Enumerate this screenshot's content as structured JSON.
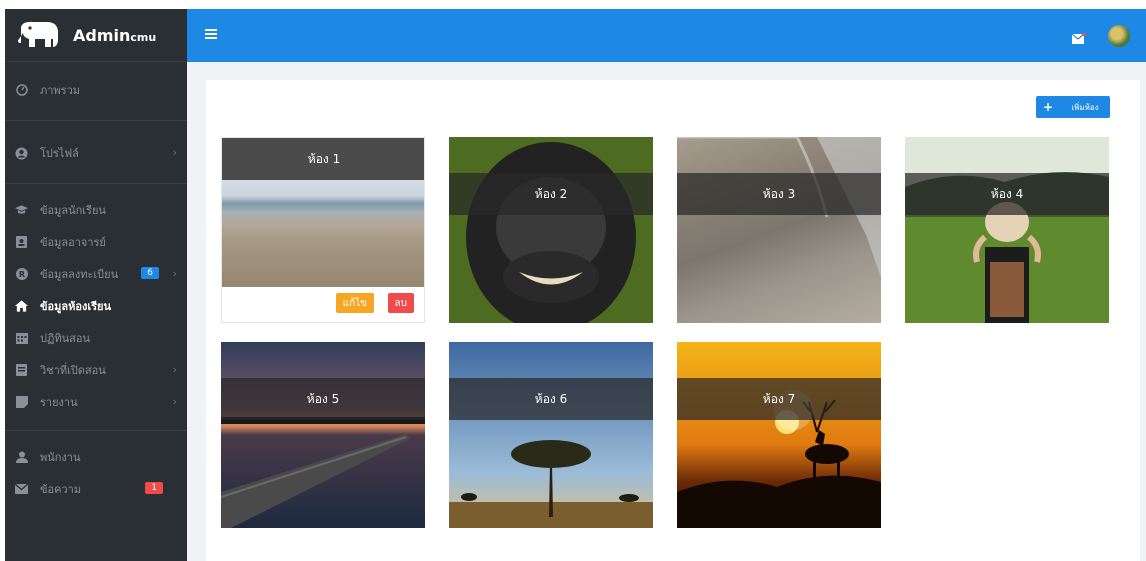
{
  "brand": {
    "name": "Admin",
    "suffix": "cmu"
  },
  "sidebar": {
    "items": [
      {
        "label": "ภาพรวม",
        "icon": "dashboard-icon"
      },
      {
        "label": "โปรไฟล์",
        "icon": "user-icon",
        "chevron": true
      },
      {
        "label": "ข้อมูลนักเรียน",
        "icon": "graduation-cap-icon"
      },
      {
        "label": "ข้อมูลอาจารย์",
        "icon": "id-card-icon"
      },
      {
        "label": "ข้อมูลลงทะเบียน",
        "icon": "registered-icon",
        "badge": "6",
        "badge_color": "#1e88e5",
        "chevron": true
      },
      {
        "label": "ข้อมูลห้องเรียน",
        "icon": "home-icon",
        "active": true
      },
      {
        "label": "ปฏิทินสอน",
        "icon": "calendar-icon"
      },
      {
        "label": "วิชาที่เปิดสอน",
        "icon": "book-icon",
        "chevron": true
      },
      {
        "label": "รายงาน",
        "icon": "report-icon",
        "chevron": true
      },
      {
        "label": "พนักงาน",
        "icon": "user-icon"
      },
      {
        "label": "ข้อความ",
        "icon": "mail-icon",
        "badge": "1",
        "badge_color": "#ef4b4b"
      }
    ]
  },
  "toolbar": {
    "add_label": "เพิ่มห้อง"
  },
  "rooms": [
    {
      "label": "ห้อง 1",
      "edit_label": "แก้ไข",
      "delete_label": "ลบ"
    },
    {
      "label": "ห้อง 2"
    },
    {
      "label": "ห้อง 3"
    },
    {
      "label": "ห้อง 4"
    },
    {
      "label": "ห้อง 5"
    },
    {
      "label": "ห้อง 6"
    },
    {
      "label": "ห้อง 7"
    }
  ],
  "colors": {
    "topbar": "#1e88e5",
    "sidebar": "#2a2f34",
    "edit": "#f6a623",
    "delete": "#ef4b4b"
  }
}
